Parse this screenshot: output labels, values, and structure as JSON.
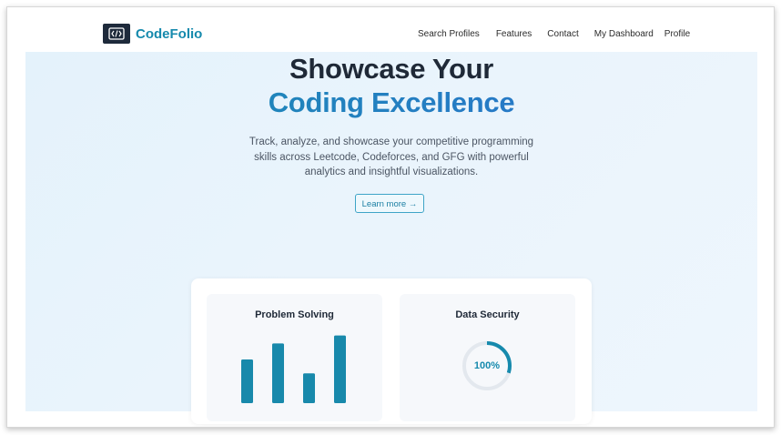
{
  "brand": {
    "name": "CodeFolio",
    "logo_icon": "code-brackets-icon"
  },
  "nav": {
    "items": [
      "Search Profiles",
      "Features",
      "Contact",
      "My Dashboard",
      "Profile"
    ]
  },
  "hero": {
    "title_line1": "Showcase Your",
    "title_line2": "Coding Excellence",
    "subtitle": "Track, analyze, and showcase your competitive programming skills across Leetcode, Codeforces, and GFG with powerful analytics and insightful visualizations.",
    "cta_label": "Learn more →"
  },
  "features": {
    "problem_solving": {
      "title": "Problem Solving",
      "bar_levels": [
        0.6,
        0.82,
        0.41,
        0.93
      ]
    },
    "data_security": {
      "title": "Data Security",
      "value": "100%",
      "ring_progress": 0.3
    }
  },
  "colors": {
    "accent": "#168aad",
    "bar": "#1889ab",
    "hero_bg": "#e8f4fc"
  }
}
